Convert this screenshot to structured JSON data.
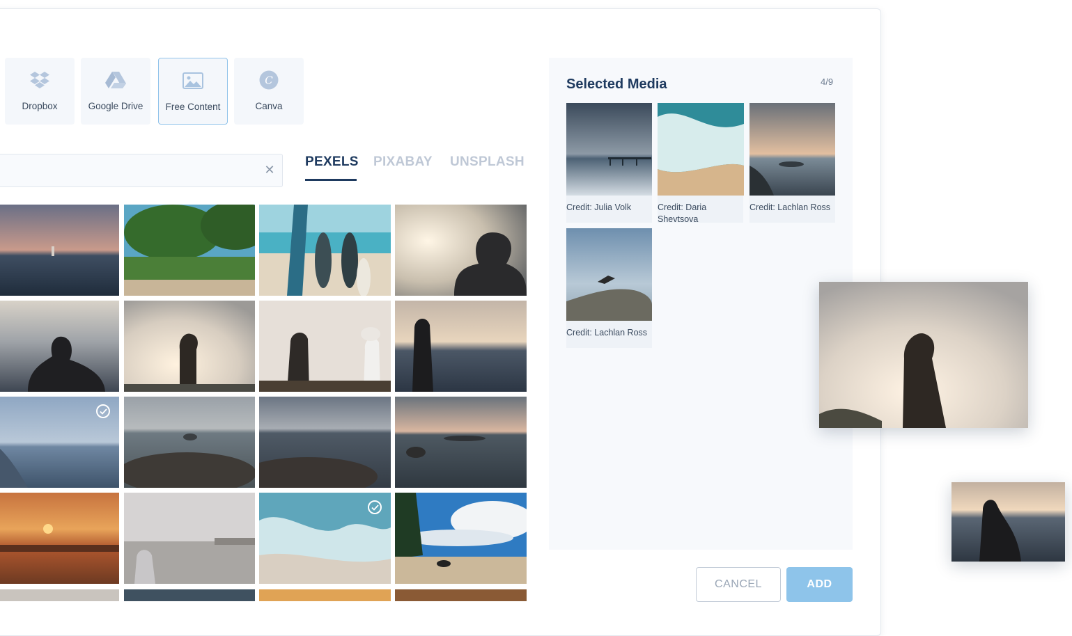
{
  "sources": [
    {
      "label": "Dropbox",
      "icon": "dropbox-icon"
    },
    {
      "label": "Google Drive",
      "icon": "google-drive-icon"
    },
    {
      "label": "Free Content",
      "icon": "image-icon",
      "active": true
    },
    {
      "label": "Canva",
      "icon": "canva-icon"
    }
  ],
  "search": {
    "value": "",
    "clear_icon": "close-icon"
  },
  "tabs": [
    {
      "label": "PEXELS",
      "active": true
    },
    {
      "label": "PIXABAY",
      "active": false
    },
    {
      "label": "UNSPLASH",
      "active": false
    }
  ],
  "panel": {
    "title": "Selected Media",
    "count": "4/9",
    "items": [
      {
        "credit": "Credit: Julia Volk"
      },
      {
        "credit": "Credit: Daria Shevtsova"
      },
      {
        "credit": "Credit: Lachlan Ross"
      },
      {
        "credit": "Credit: Lachlan Ross"
      }
    ]
  },
  "buttons": {
    "cancel": "CANCEL",
    "add": "ADD"
  },
  "colors": {
    "accent": "#8ec4ea",
    "title": "#1e3a5f",
    "inactive_tab": "#bfc8d6"
  }
}
